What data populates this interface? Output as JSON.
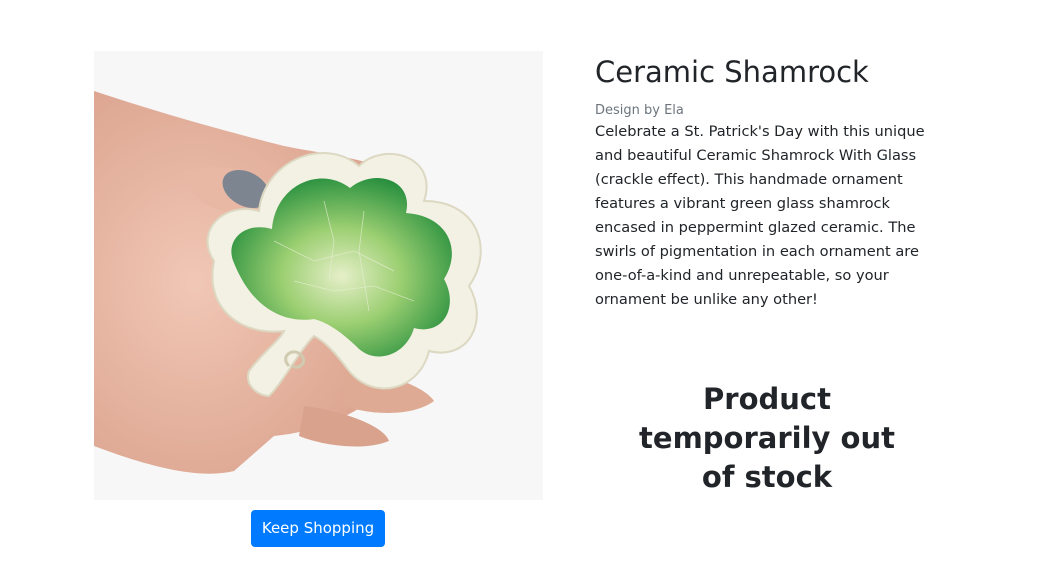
{
  "product": {
    "title": "Ceramic Shamrock",
    "designer": "Design by Ela",
    "description": "Celebrate a St. Patrick's Day with this unique and beautiful Ceramic Shamrock With Glass (crackle effect). This handmade ornament features a vibrant green glass shamrock encased in peppermint glazed ceramic. The swirls of pigmentation in each ornament are one-of-a-kind and unrepeatable, so your ornament be unlike any other!",
    "stock_status": "Product temporarily out of stock",
    "image_icon": "shamrock-photo"
  },
  "actions": {
    "keep_shopping_label": "Keep Shopping"
  },
  "colors": {
    "primary": "#007bff",
    "text": "#212529",
    "muted": "#6c757d",
    "glass_green": "#2e9d46",
    "ceramic": "#f3f1e4"
  }
}
